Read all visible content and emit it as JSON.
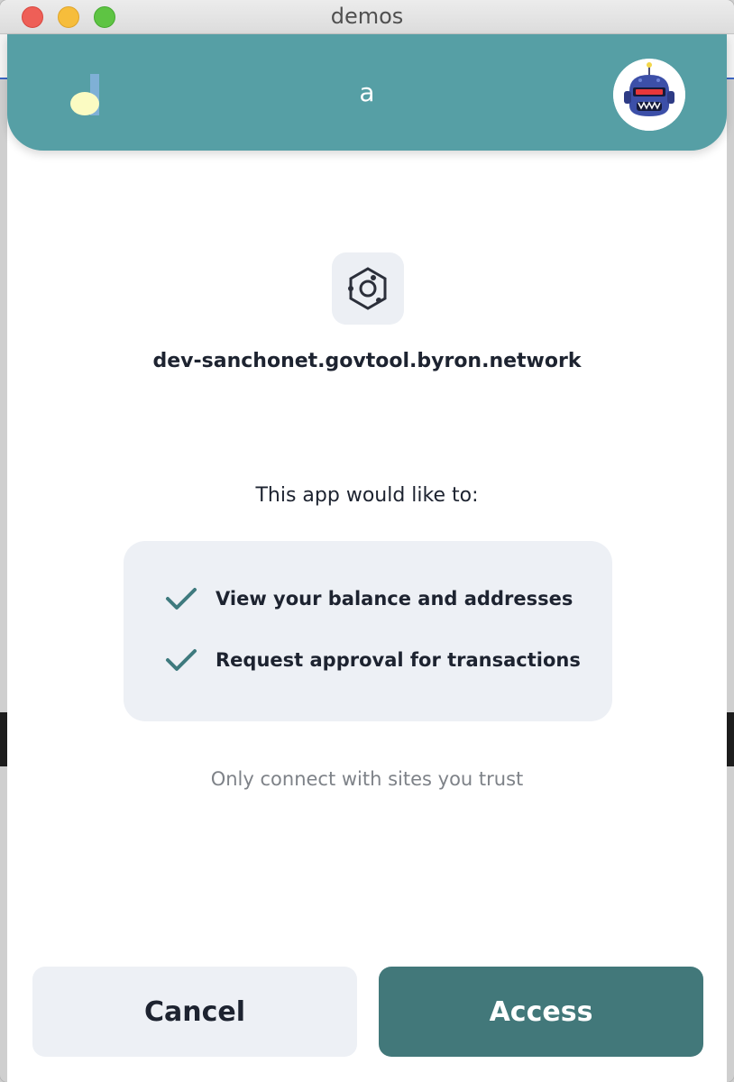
{
  "window": {
    "title": "demos"
  },
  "header": {
    "account_name": "a",
    "logo_icon": "wallet-logo-icon",
    "avatar_icon": "robot-avatar-icon"
  },
  "site": {
    "icon": "dapp-hexagon-icon",
    "domain": "dev-sanchonet.govtool.byron.network"
  },
  "request": {
    "heading": "This app would like to:",
    "permissions": [
      {
        "label": "View your balance and addresses",
        "icon": "check-icon"
      },
      {
        "label": "Request approval for transactions",
        "icon": "check-icon"
      }
    ],
    "trust_note": "Only connect with sites you trust"
  },
  "actions": {
    "cancel_label": "Cancel",
    "access_label": "Access"
  },
  "colors": {
    "header_teal": "#569fa5",
    "primary_button": "#42787a",
    "check": "#3e7a7e",
    "panel_bg": "#edf0f5",
    "text_dark": "#1d2330",
    "text_muted": "#7e8288"
  }
}
